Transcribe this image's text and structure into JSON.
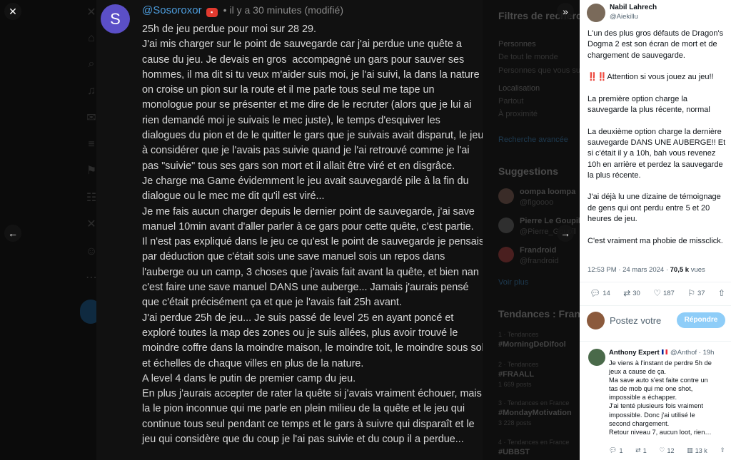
{
  "viewer": {
    "close_icon": "close-icon",
    "prev_icon": "arrow-left-icon",
    "next_icon": "arrow-right-icon",
    "collapse_icon": "double-chevron-right-icon"
  },
  "background_ui": {
    "filter_title": "Filtres de recherche",
    "people_label": "Personnes",
    "people_opt1": "De tout le monde",
    "people_opt2": "Personnes que vous suivez",
    "location_label": "Localisation",
    "location_opt1": "Partout",
    "location_opt2": "À proximité",
    "advanced_link": "Recherche avancée",
    "suggestions_title": "Suggestions",
    "suggestion1_name": "oompa loompa",
    "suggestion1_handle": "@figoooo",
    "suggestion2_name": "Pierre Le Goupil",
    "suggestion2_handle": "@Pierre_Goupil",
    "suggestion3_name": "Frandroid",
    "suggestion3_handle": "@frandroid",
    "show_more": "Voir plus",
    "trends_title": "Tendances : France",
    "trend1_meta": "1 · Tendances",
    "trend1": "#MorningDeDifool",
    "trend2_meta": "2 · Tendances",
    "trend2": "#FRAALL",
    "trend2_count": "1 669 posts",
    "trend3_meta": "3 · Tendances en France",
    "trend3": "#MondayMotivation",
    "trend3_count": "3 228 posts",
    "trend4_meta": "4 · Tendances en France",
    "trend4": "#UBBST"
  },
  "screenshot": {
    "avatar_letter": "S",
    "username": "@Sosoroxor",
    "timestamp": "il y a 30 minutes (modifié)",
    "paragraphs": [
      "25h de jeu perdue pour moi sur 28 29.",
      "J'ai mis charger sur le point de sauvegarde car j'ai perdue une quête a cause du jeu. Je devais en gros  accompagné un gars pour sauver ses hommes, il ma dit si tu veux m'aider suis moi, je l'ai suivi, la dans la nature on croise un pion sur la route et il me parle tous seul me tape un monologue pour se présenter et me dire de le recruter (alors que je lui ai rien demandé moi je suivais le mec juste), le temps d'esquiver les dialogues du pion et de le quitter le gars que je suivais avait disparut, le jeu à considérer que je l'avais pas suivie quand je l'ai retrouvé comme je l'ai pas \"suivie\" tous ses gars son mort et il allait être viré et en disgrâce.",
      "Je charge ma Game évidemment le jeu avait sauvegardé pile à la fin du dialogue ou le mec me dit qu'il est viré...",
      "Je me fais aucun charger depuis le dernier point de sauvegarde, j'ai save manuel 10min avant d'aller parler à ce gars pour cette quête, c'est partie.",
      "Il n'est pas expliqué dans le jeu ce qu'est le point de sauvegarde je pensais par déduction que c'était sois une save manuel sois un repos dans l'auberge ou un camp, 3 choses que j'avais fait avant la quête, et bien nan c'est faire une save manuel DANS une auberge... Jamais j'aurais pensé que c'était précisément ça et que je l'avais fait 25h avant.",
      "J'ai perdue 25h de jeu... Je suis passé de level 25 en ayant poncé et exploré toutes la map des zones ou je suis allées, plus avoir trouvé le moindre coffre dans la moindre maison, le moindre toit, le moindre sous sol et échelles de chaque villes en plus de la nature.",
      "A level 4 dans le putin de premier camp du jeu.",
      "En plus j'aurais accepter de rater la quête si j'avais vraiment échouer, mais la le pion inconnue qui me parle en plein milieu de la quête et le jeu qui continue tous seul pendant ce temps et le gars à suivre qui disparaît et le jeu qui considère que du coup je l'ai pas suivie et du coup il a perdue..."
    ]
  },
  "tweet": {
    "author_name": "Nabil Lahrech",
    "author_handle": "@Aiekillu",
    "paragraphs": [
      "L'un des plus gros défauts de Dragon's Dogma 2 est son écran de mort et de chargement de sauvegarde.",
      "‼️‼️Attention si vous jouez au jeu!!",
      "La première option charge la sauvegarde la plus récente, normal",
      "La deuxième option charge la dernière sauvegarde DANS UNE AUBERGE!! Et si c'était il y a 10h, bah vous revenez 10h en arrière et perdez la sauvegarde la plus récente.",
      "J'ai déjà lu une dizaine de témoignage de gens qui ont perdu entre 5 et 20 heures de jeu.",
      "C'est vraiment ma phobie de missclick."
    ],
    "time": "12:53 PM · 24 mars 2024 · ",
    "views_value": "70,5 k",
    "views_label": " vues",
    "replies": "14",
    "retweets": "30",
    "likes": "187",
    "bookmarks": "37",
    "reply_placeholder": "Postez votre",
    "reply_button": "Répondre"
  },
  "comment": {
    "name": "Anthony Expert",
    "handle": "@Anthof",
    "time": "· 19h",
    "lines": [
      "Je viens à l'instant de perdre 5h de",
      "jeux a cause de ça.",
      "Ma save auto s'est faite contre un",
      "tas de mob qui me one shot,",
      "impossible a échapper.",
      "J'ai tenté plusieurs fois vraiment",
      "impossible. Donc j'ai utilisé le",
      "second chargement.",
      "Retour niveau 7, aucun loot, rien…"
    ],
    "replies": "1",
    "retweets": "1",
    "likes": "12",
    "views": "13 k"
  }
}
